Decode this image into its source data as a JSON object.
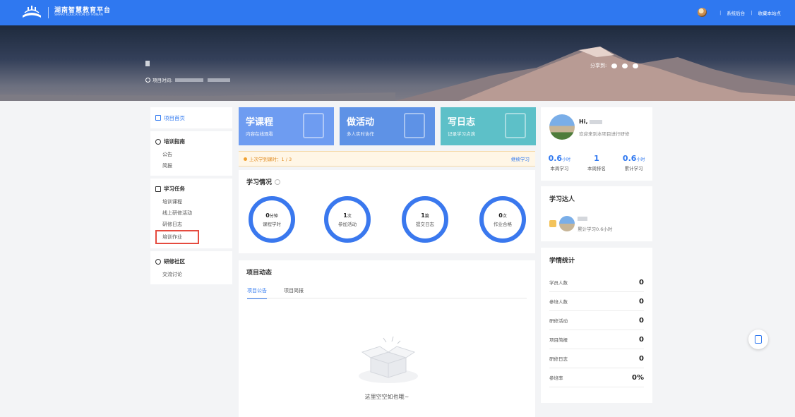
{
  "header": {
    "logo_cn": "湖南智慧教育平台",
    "logo_en": "SMART EDUCATION OF HUNAN",
    "admin_link": "系统后台",
    "bookmark_link": "收藏本站点",
    "separator": "|"
  },
  "banner": {
    "time_label": "项目时间:",
    "share_label": "分享到:"
  },
  "nav": {
    "home": "项目首页",
    "guide": {
      "title": "培训指南",
      "items": [
        "公告",
        "简报"
      ]
    },
    "tasks": {
      "title": "学习任务",
      "items": [
        "培训课程",
        "线上研修活动",
        "研修日志",
        "培训作业"
      ]
    },
    "community": {
      "title": "研修社区",
      "items": [
        "交流讨论"
      ]
    }
  },
  "cards": [
    {
      "title": "学课程",
      "sub": "内容在线观看"
    },
    {
      "title": "做活动",
      "sub": "多人实时协作"
    },
    {
      "title": "写日志",
      "sub": "记录学习点滴"
    }
  ],
  "notice": {
    "text": "上次学到课时：1 / 3",
    "link": "继续学习"
  },
  "study": {
    "title": "学习情况",
    "rings": [
      {
        "value": "0",
        "unit": "分钟",
        "label": "课程学时"
      },
      {
        "value": "1",
        "unit": "次",
        "label": "参加活动"
      },
      {
        "value": "1",
        "unit": "篇",
        "label": "提交日志"
      },
      {
        "value": "0",
        "unit": "次",
        "label": "作业合格"
      }
    ]
  },
  "dynamics": {
    "title": "项目动态",
    "tabs": [
      "项目公告",
      "项目简报"
    ],
    "empty": "这里空空如也哦~"
  },
  "user": {
    "hi": "Hi,",
    "welcome": "欢迎来到本项目进行研修",
    "stats": [
      {
        "value": "0.6",
        "unit": "小时",
        "label": "本周学习"
      },
      {
        "value": "1",
        "unit": "",
        "label": "本周排名"
      },
      {
        "value": "0.6",
        "unit": "小时",
        "label": "累计学习"
      }
    ]
  },
  "talent": {
    "title": "学习达人",
    "meta": "累计学习0.6小时"
  },
  "stats": {
    "title": "学情统计",
    "rows": [
      {
        "label": "学员人数",
        "value": "0"
      },
      {
        "label": "参培人数",
        "value": "0"
      },
      {
        "label": "研修活动",
        "value": "0"
      },
      {
        "label": "项目简报",
        "value": "0"
      },
      {
        "label": "研修日志",
        "value": "0"
      },
      {
        "label": "参培率",
        "value": "0%"
      }
    ]
  },
  "colors": {
    "primary": "#2f78f0",
    "card1": "#6e9cf1",
    "card2": "#5e92e6",
    "card3": "#5dc0c8",
    "highlight": "#e54b3f"
  }
}
